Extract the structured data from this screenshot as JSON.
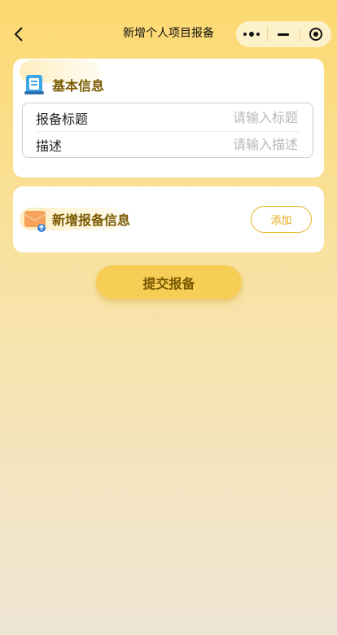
{
  "nav": {
    "title": "新增个人项目报备"
  },
  "basic_info": {
    "title": "基本信息",
    "fields": [
      {
        "label": "报备标题",
        "placeholder": "请输入标题"
      },
      {
        "label": "描述",
        "placeholder": "请输入描述"
      }
    ]
  },
  "add_section": {
    "title": "新增报备信息",
    "add_label": "添加"
  },
  "submit_label": "提交报备",
  "colors": {
    "accent": "#f6cd55",
    "title_text": "#7a5a00",
    "add_border": "#e6b422"
  }
}
